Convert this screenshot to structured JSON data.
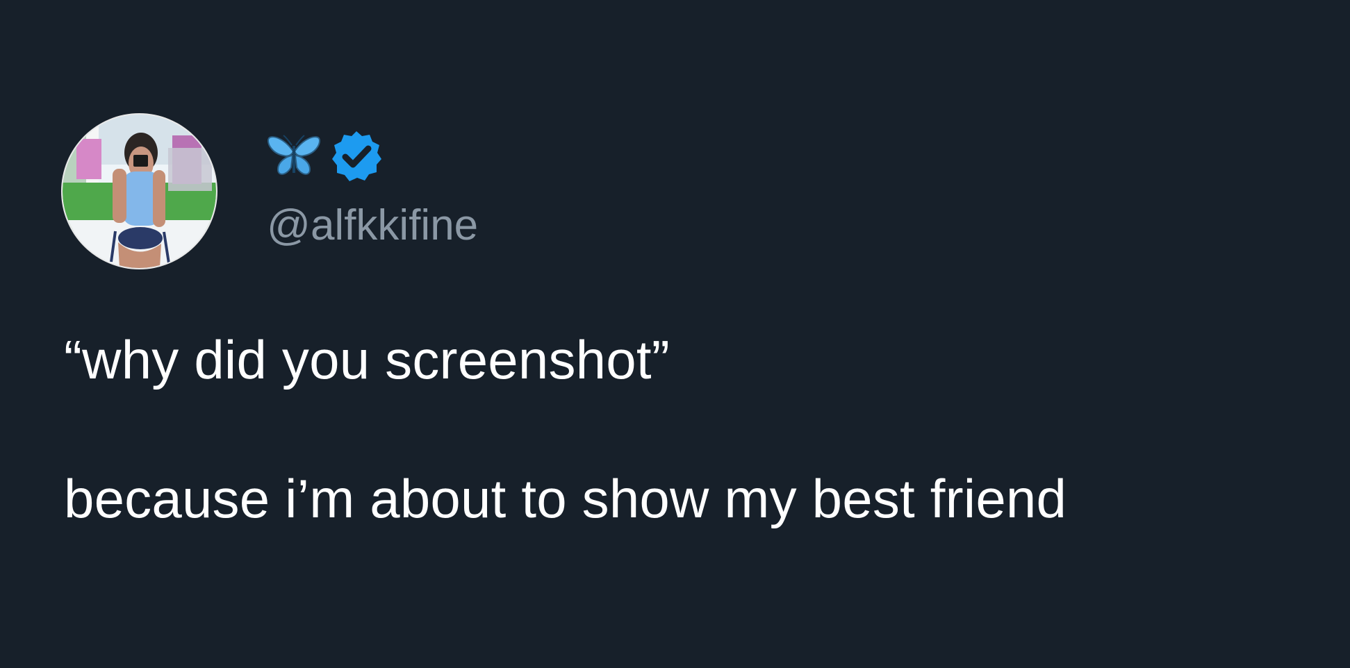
{
  "tweet": {
    "display_name_icon": "butterfly-emoji-icon",
    "verified_icon": "verified-badge-icon",
    "handle": "@alfkkifine",
    "lines": [
      "“why did you screenshot”",
      "",
      "because i’m about to show my best friend"
    ]
  },
  "colors": {
    "background": "#17202a",
    "text_primary": "#ffffff",
    "text_secondary": "#8b98a5",
    "verified_blue": "#1d9bf0",
    "butterfly_blue": "#5ab4f0"
  }
}
